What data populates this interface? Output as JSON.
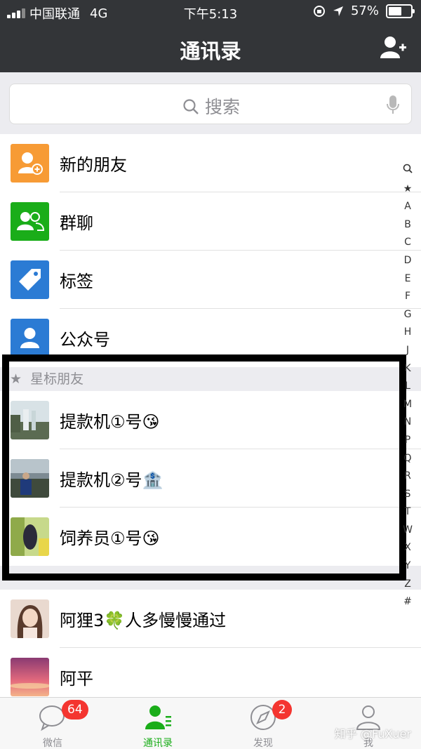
{
  "status": {
    "carrier": "中国联通",
    "network": "4G",
    "time": "下午5:13",
    "battery": "57%"
  },
  "nav": {
    "title": "通讯录"
  },
  "search": {
    "placeholder": "搜索"
  },
  "functions": [
    {
      "label": "新的朋友",
      "color": "#f79b35"
    },
    {
      "label": "群聊",
      "color": "#1aad19"
    },
    {
      "label": "标签",
      "color": "#2b7bd4"
    },
    {
      "label": "公众号",
      "color": "#2b7bd4"
    }
  ],
  "starred": {
    "header": "星标朋友",
    "contacts": [
      {
        "name": "提款机①号",
        "emoji": "😘"
      },
      {
        "name": "提款机②号",
        "emoji": "🏦"
      },
      {
        "name": "饲养员①号",
        "emoji": "😘"
      }
    ]
  },
  "contacts": [
    {
      "name_a": "阿狸3",
      "emoji": "🍀",
      "name_b": "人多慢慢通过"
    },
    {
      "name_a": "阿平"
    }
  ],
  "index": [
    "Q",
    "★",
    "A",
    "B",
    "C",
    "D",
    "E",
    "F",
    "G",
    "H",
    "J",
    "K",
    "L",
    "M",
    "N",
    "P",
    "Q",
    "R",
    "S",
    "T",
    "W",
    "X",
    "Y",
    "Z",
    "#"
  ],
  "tabs": [
    {
      "label": "微信",
      "badge": "64"
    },
    {
      "label": "通讯录"
    },
    {
      "label": "发现",
      "badge": "2"
    },
    {
      "label": "我"
    }
  ],
  "watermark": "知乎 @FuXuer",
  "colors": {
    "accent": "#1aad19",
    "badge": "#f43530",
    "header_bg": "#333538"
  }
}
